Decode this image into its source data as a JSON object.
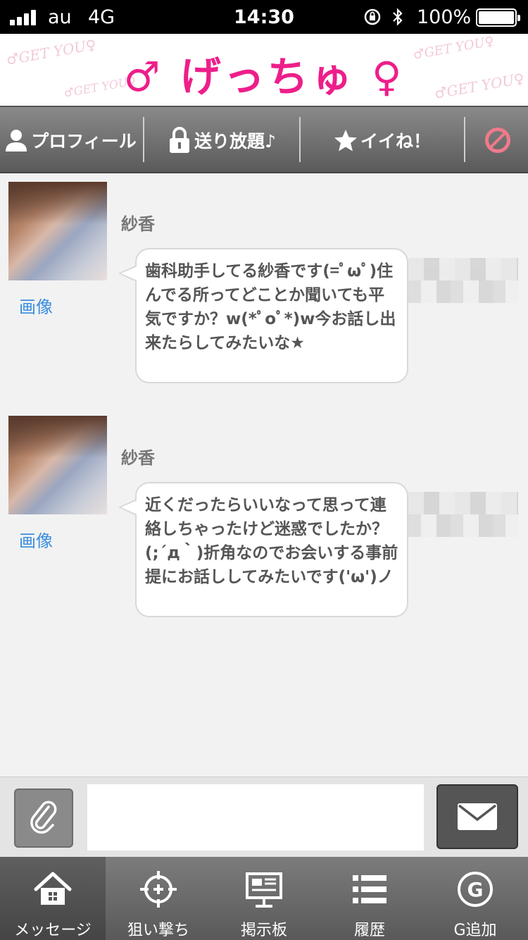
{
  "status_bar": {
    "carrier": "au",
    "network": "4G",
    "time": "14:30",
    "battery_percent": "100%",
    "icons": [
      "signal-icon",
      "orientation-lock-icon",
      "bluetooth-icon",
      "battery-icon"
    ]
  },
  "header": {
    "logo": "♂ げっちゅ ♀",
    "watermark": "♂GET YOU♀"
  },
  "actions": {
    "profile": "プロフィール",
    "unlimited": "送り放題♪",
    "like": "イイね！",
    "block_icon": "block-icon"
  },
  "messages": [
    {
      "sender": "紗香",
      "image_link": "画像",
      "text": "歯科助手してる紗香です(=ﾟωﾟ)住んでる所ってどことか聞いても平気ですか？w(*ﾟoﾟ*)w今お話し出来たらしてみたいな★"
    },
    {
      "sender": "紗香",
      "image_link": "画像",
      "text": "近くだったらいいなって思って連絡しちゃったけど迷惑でしたか？(;´д｀)折角なのでお会いする事前提にお話ししてみたいです('ω')ノ"
    }
  ],
  "compose": {
    "placeholder": "",
    "attach_icon": "paperclip-icon",
    "send_icon": "envelope-icon"
  },
  "tabs": [
    {
      "label": "メッセージ",
      "icon": "home-icon",
      "active": true
    },
    {
      "label": "狙い撃ち",
      "icon": "target-icon",
      "active": false
    },
    {
      "label": "掲示板",
      "icon": "board-icon",
      "active": false
    },
    {
      "label": "履歴",
      "icon": "list-icon",
      "active": false
    },
    {
      "label": "G追加",
      "icon": "g-circle-icon",
      "active": false
    }
  ],
  "colors": {
    "accent_pink": "#ee1e8a",
    "link_blue": "#3a8ee0",
    "block_red": "#f07a8a"
  }
}
